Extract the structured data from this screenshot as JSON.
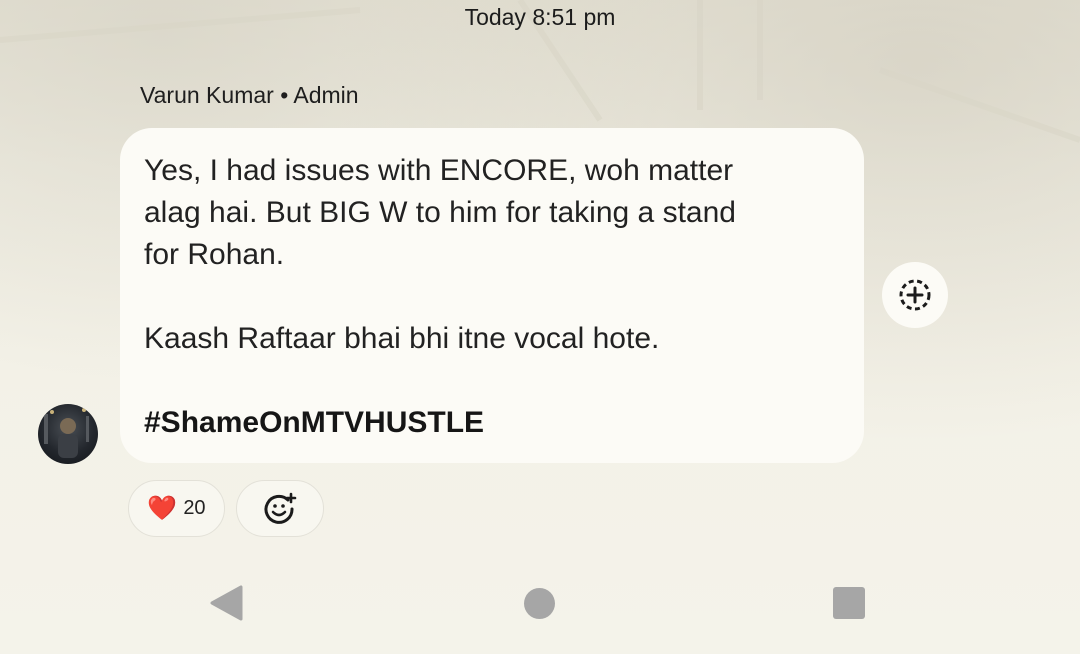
{
  "header": {
    "timestamp": "Today 8:51 pm"
  },
  "message": {
    "sender": "Varun Kumar • Admin",
    "lines": [
      "Yes, I had issues with ENCORE, woh matter",
      "alag hai. But BIG W to him for taking a stand",
      "for Rohan."
    ],
    "line_after_gap": "Kaash Raftaar bhai bhi itne vocal hote.",
    "hashtag": "#ShameOnMTVHUSTLE"
  },
  "reactions": {
    "emoji": "❤️",
    "count": "20"
  },
  "icons": {
    "share": "add-circle-dashed-icon",
    "add_reaction": "add-emoji-icon",
    "nav_back": "back-triangle-icon",
    "nav_home": "home-circle-icon",
    "nav_recent": "recent-square-icon"
  },
  "colors": {
    "bubble": "#fcfbf6",
    "background": "#f3f1e6",
    "nav_icons": "#a6a6a6",
    "heart": "#e0283b"
  }
}
